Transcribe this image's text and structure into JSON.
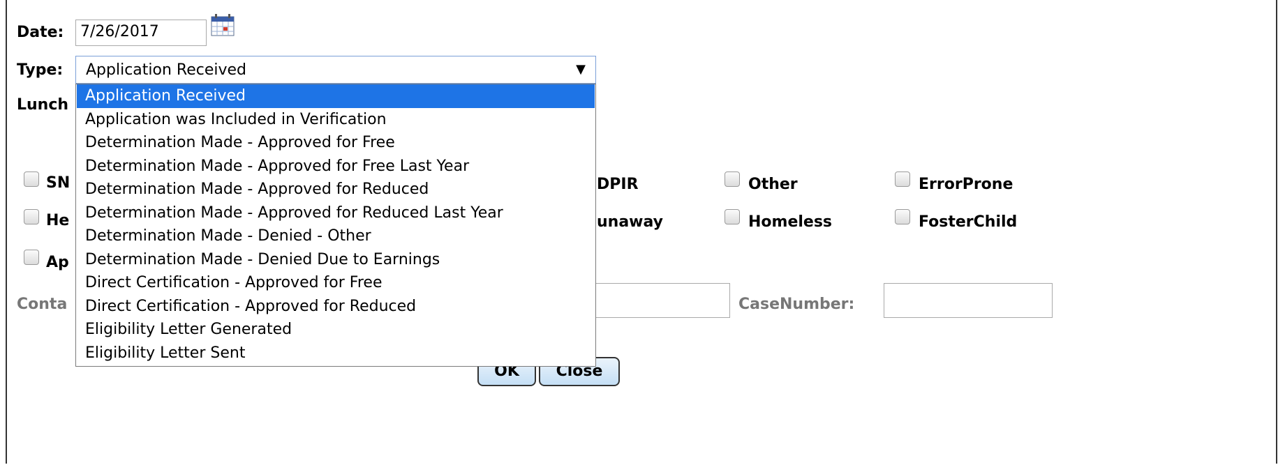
{
  "form": {
    "date_label": "Date:",
    "date_value": "7/26/2017",
    "type_label": "Type:",
    "type_selected": "Application Received",
    "lunch_label_partial": "Lunch",
    "contact_label_partial": "Conta",
    "casenumber_label": "CaseNumber:",
    "contact_value": "",
    "casenumber_value": ""
  },
  "dropdown": {
    "arrow_glyph": "▼",
    "options": [
      "Application Received",
      "Application was Included in Verification",
      "Determination Made - Approved for Free",
      "Determination Made - Approved for Free Last Year",
      "Determination Made - Approved for Reduced",
      "Determination Made - Approved for Reduced Last Year",
      "Determination Made - Denied - Other",
      "Determination Made - Denied Due to Earnings",
      "Direct Certification - Approved for Free",
      "Direct Certification - Approved for Reduced",
      "Eligibility Letter Generated",
      "Eligibility Letter Sent"
    ],
    "selected_index": 0
  },
  "checkboxes": {
    "snap_partial": "SN",
    "head_start_partial": "He",
    "app_partial": "Ap",
    "fdpir_partial": "DPIR",
    "runaway_partial": "unaway",
    "other": "Other",
    "homeless": "Homeless",
    "error_prone": "ErrorProne",
    "foster_child": "FosterChild"
  },
  "buttons": {
    "ok": "OK",
    "close": "Close"
  },
  "icons": {
    "calendar": "calendar-icon",
    "dropdown_arrow": "chevron-down-icon"
  },
  "colors": {
    "selection_highlight": "#1e74e6",
    "select_border": "#7a9fd8",
    "button_fill": "#c5dff5",
    "label_grey": "#777777"
  }
}
